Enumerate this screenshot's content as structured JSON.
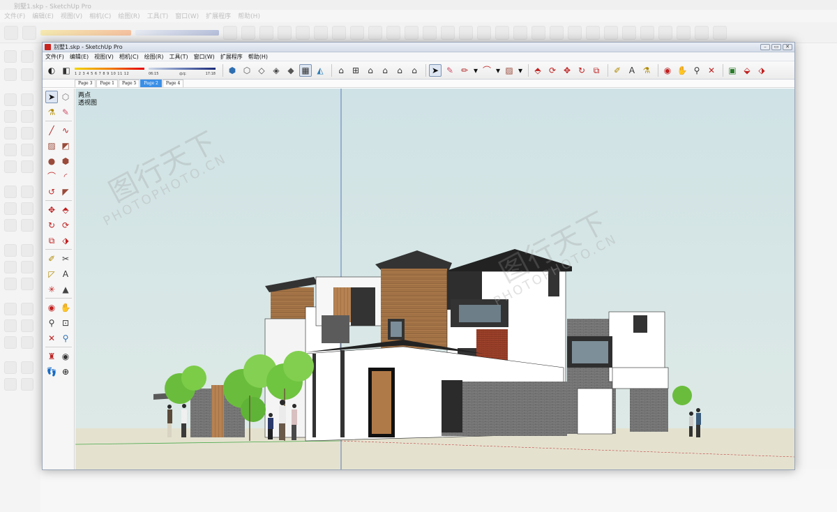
{
  "window": {
    "title": "别墅1.skp - SketchUp Pro",
    "controls": [
      "–",
      "▭",
      "✕"
    ]
  },
  "background_app": {
    "title": "别墅1.skp - SketchUp Pro",
    "menu": [
      "文件(F)",
      "编辑(E)",
      "视图(V)",
      "相机(C)",
      "绘图(R)",
      "工具(T)",
      "窗口(W)",
      "扩展程序",
      "帮助(H)"
    ]
  },
  "menubar": {
    "items": [
      "文件(F)",
      "编辑(E)",
      "视图(V)",
      "相机(C)",
      "绘图(R)",
      "工具(T)",
      "窗口(W)",
      "扩展程序",
      "帮助(H)"
    ]
  },
  "toolbar": {
    "shadow_months": "1 2 3 4 5 6 7 8 9 10 11 12",
    "time_start": "06:15",
    "time_mid": "中午",
    "time_end": "17:18"
  },
  "tabs": [
    {
      "label": "Page 3",
      "active": false
    },
    {
      "label": "Page 1",
      "active": false
    },
    {
      "label": "Page 5",
      "active": false
    },
    {
      "label": "Page 2",
      "active": true
    },
    {
      "label": "Page 4",
      "active": false
    }
  ],
  "viewport": {
    "camera_mode": "两点",
    "projection": "透视图",
    "watermark_cn": "图行天下",
    "watermark_en": "PHOTOPHOTO.CN",
    "sky_color": "#d2e3e6",
    "ground_color": "#e3e1cd"
  }
}
